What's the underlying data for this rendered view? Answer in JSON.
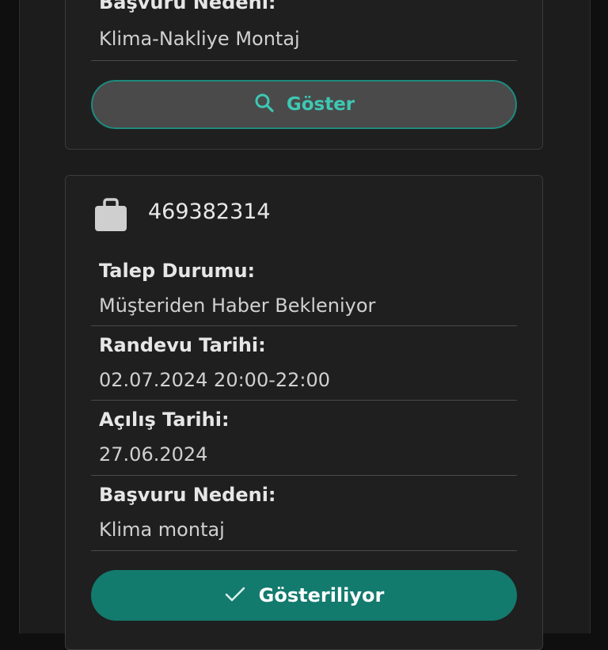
{
  "card_top": {
    "reason_label": "Başvuru Nedeni:",
    "reason_value": "Klima-Nakliye Montaj",
    "show_button_label": "Göster"
  },
  "card_bottom": {
    "ticket_id": "469382314",
    "status_label": "Talep Durumu:",
    "status_value": "Müşteriden Haber Bekleniyor",
    "appointment_label": "Randevu Tarihi:",
    "appointment_value": "02.07.2024 20:00-22:00",
    "opening_label": "Açılış Tarihi:",
    "opening_value": "27.06.2024",
    "reason_label": "Başvuru Nedeni:",
    "reason_value": "Klima montaj",
    "showing_button_label": "Gösteriliyor"
  },
  "colors": {
    "accent_teal": "#3cc8b4",
    "button_teal": "#137a6e",
    "background": "#1c1c1c"
  },
  "icons": {
    "show_button": "search-icon",
    "showing_button": "check-icon",
    "ticket": "briefcase-icon"
  }
}
